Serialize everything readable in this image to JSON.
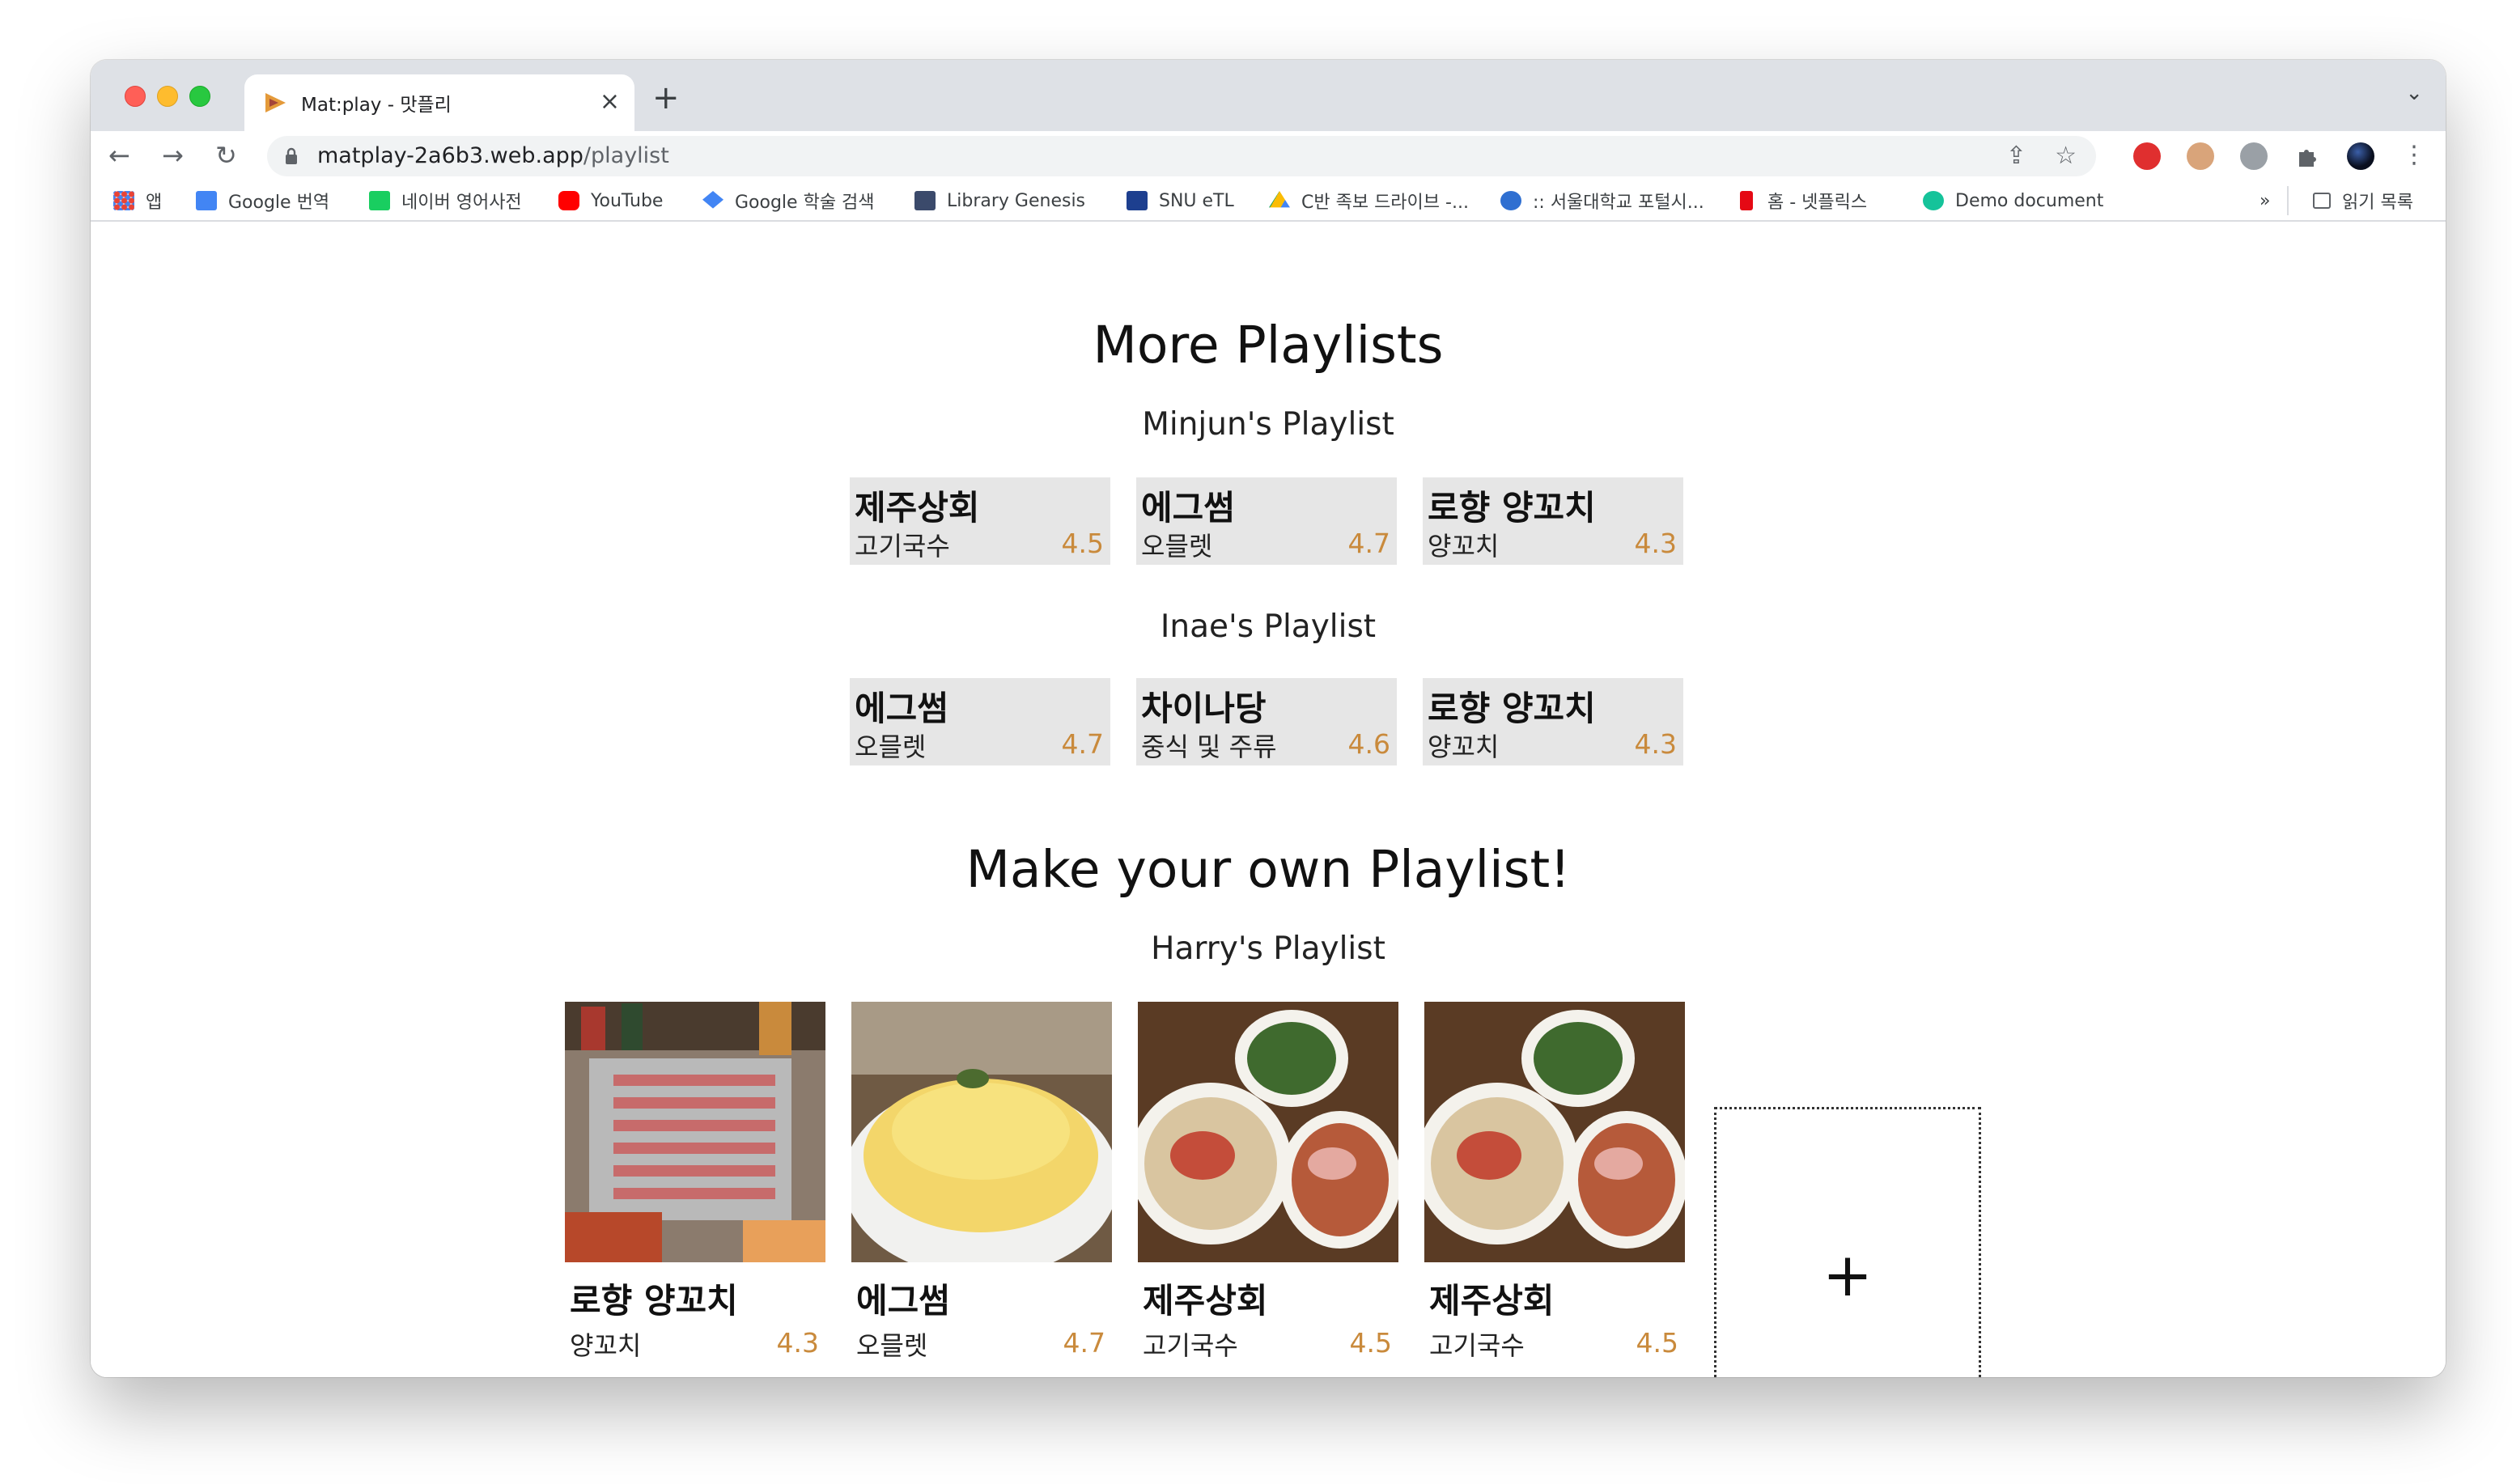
{
  "browser": {
    "tab_title": "Mat:play - 맛플리",
    "tab_close": "×",
    "new_tab": "+",
    "tab_menu": "⌄",
    "url_host": "matplay-2a6b3.web.app",
    "url_path": "/playlist",
    "nav": {
      "back": "←",
      "forward": "→",
      "reload": "↻"
    },
    "omnibox_icons": {
      "share": "⇪",
      "star": "☆"
    },
    "menu": "⋮",
    "bookmarks": [
      {
        "label": "앱",
        "icon": "apps-grid-icon",
        "color": "#4285f4"
      },
      {
        "label": "Google 번역",
        "icon": "google-translate-icon",
        "color": "#4285f4"
      },
      {
        "label": "네이버 영어사전",
        "icon": "naver-dictionary-icon",
        "color": "#19ce60"
      },
      {
        "label": "YouTube",
        "icon": "youtube-icon",
        "color": "#ff0000"
      },
      {
        "label": "Google 학술 검색",
        "icon": "google-scholar-icon",
        "color": "#4285f4"
      },
      {
        "label": "Library Genesis",
        "icon": "library-genesis-icon",
        "color": "#3b4a6b"
      },
      {
        "label": "SNU eTL",
        "icon": "snu-etl-icon",
        "color": "#1d3f8f"
      },
      {
        "label": "C반 족보 드라이브 -...",
        "icon": "google-drive-icon",
        "color": "#fbbc04"
      },
      {
        "label": ":: 서울대학교 포털시...",
        "icon": "snu-portal-icon",
        "color": "#2f6fd1"
      },
      {
        "label": "홈 - 넷플릭스",
        "icon": "netflix-icon",
        "color": "#e50914"
      },
      {
        "label": "Demo document",
        "icon": "grammarly-icon",
        "color": "#15c39a"
      }
    ],
    "bookmarks_overflow": "»",
    "reading_list": "읽기 목록"
  },
  "page": {
    "more_title": "More Playlists",
    "make_title": "Make your own Playlist!",
    "add_label": "+",
    "playlists": [
      {
        "name": "Minjun's Playlist",
        "items": [
          {
            "name": "제주상회",
            "category": "고기국수",
            "rating": "4.5"
          },
          {
            "name": "에그썸",
            "category": "오믈렛",
            "rating": "4.7"
          },
          {
            "name": "로향 양꼬치",
            "category": "양꼬치",
            "rating": "4.3"
          }
        ]
      },
      {
        "name": "Inae's Playlist",
        "items": [
          {
            "name": "에그썸",
            "category": "오믈렛",
            "rating": "4.7"
          },
          {
            "name": "차이나당",
            "category": "중식 및 주류",
            "rating": "4.6"
          },
          {
            "name": "로향 양꼬치",
            "category": "양꼬치",
            "rating": "4.3"
          }
        ]
      }
    ],
    "own_playlist": {
      "name": "Harry's Playlist",
      "items": [
        {
          "name": "로향 양꼬치",
          "category": "양꼬치",
          "rating": "4.3",
          "image": "lamb-skewers-photo"
        },
        {
          "name": "에그썸",
          "category": "오믈렛",
          "rating": "4.7",
          "image": "omelette-photo"
        },
        {
          "name": "제주상회",
          "category": "고기국수",
          "rating": "4.5",
          "image": "meat-noodle-soup-photo"
        },
        {
          "name": "제주상회",
          "category": "고기국수",
          "rating": "4.5",
          "image": "meat-noodle-soup-photo"
        }
      ]
    }
  },
  "colors": {
    "rating": "#c98a3c",
    "card_bg": "#e6e6e6"
  }
}
